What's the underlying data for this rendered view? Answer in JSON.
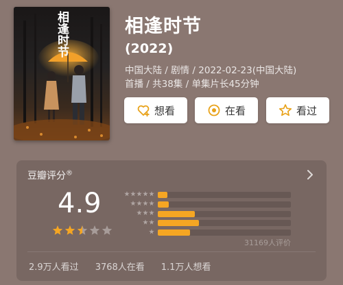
{
  "movie": {
    "title": "相逢时节",
    "year": "(2022)",
    "meta_line1": "中国大陆 / 剧情 / 2022-02-23(中国大陆)",
    "meta_line2": "首播 / 共38集 / 单集片长45分钟",
    "poster_title_text": "相逢时节"
  },
  "actions": {
    "want_label": "想看",
    "watching_label": "在看",
    "watched_label": "看过"
  },
  "rating": {
    "label": "豆瓣评分",
    "registered_mark": "®",
    "score": "4.9",
    "star_rating": 2.5,
    "distribution": [
      {
        "stars": 5,
        "fraction": 0.07
      },
      {
        "stars": 4,
        "fraction": 0.08
      },
      {
        "stars": 3,
        "fraction": 0.28
      },
      {
        "stars": 2,
        "fraction": 0.31
      },
      {
        "stars": 1,
        "fraction": 0.24
      }
    ],
    "votes": "31169人评价"
  },
  "stats": {
    "watched": "2.9万人看过",
    "watching": "3768人在看",
    "want": "1.1万人想看"
  },
  "colors": {
    "background": "#8a7771",
    "accent": "#f5a623",
    "button_icon": "#e8a21a"
  }
}
